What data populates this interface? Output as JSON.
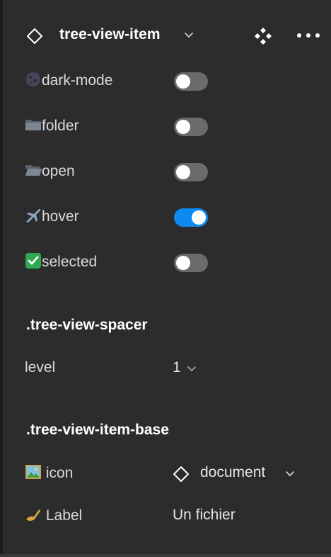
{
  "header": {
    "component_name": "tree-view-item"
  },
  "variant_props": [
    {
      "emoji": "dark-moon-icon",
      "label": "dark-mode",
      "on": false
    },
    {
      "emoji": "folder-icon",
      "label": "folder",
      "on": false
    },
    {
      "emoji": "open-folder-icon",
      "label": "open",
      "on": false
    },
    {
      "emoji": "airplane-icon",
      "label": "hover",
      "on": true
    },
    {
      "emoji": "check-mark-icon",
      "label": "selected",
      "on": false
    }
  ],
  "spacer_section": {
    "title": ".tree-view-spacer",
    "level_label": "level",
    "level_value": "1"
  },
  "base_section": {
    "title": ".tree-view-item-base",
    "icon_label": "icon",
    "icon_value": "document",
    "label_label": "Label",
    "label_value": "Un fichier"
  },
  "colors": {
    "panel_bg": "#2c2c2c",
    "toggle_off": "#6b6b6b",
    "toggle_on": "#0d8af0",
    "text": "#e6e6e6"
  }
}
